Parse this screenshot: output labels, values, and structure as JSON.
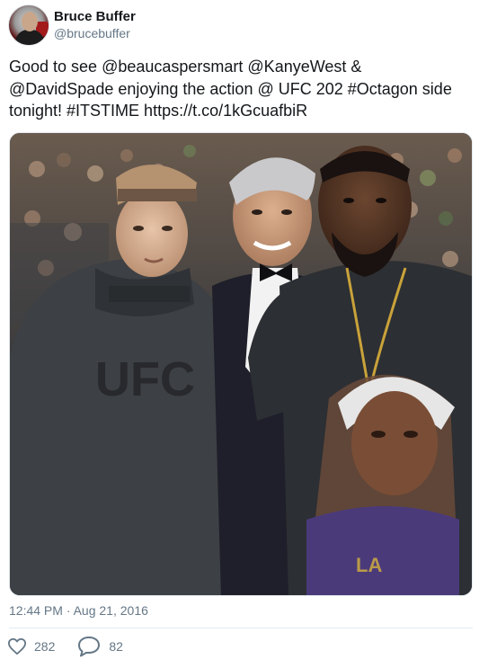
{
  "author": {
    "display_name": "Bruce Buffer",
    "handle": "@brucebuffer"
  },
  "tweet": {
    "text": "Good to see @beaucaspersmart @KanyeWest &\n@DavidSpade enjoying the action @ UFC 202 #Octagon side\ntonight! #ITSTIME https://t.co/1kGcuafbiR",
    "photo_shirt_text": "UFC",
    "timestamp": "12:44 PM · Aug 21, 2016"
  },
  "actions": {
    "like_icon": "heart-icon",
    "like_count": "282",
    "reply_icon": "speech-bubble-icon",
    "reply_count": "82"
  },
  "colors": {
    "text": "#14171a",
    "secondary": "#657786",
    "divider": "#e6ecf0"
  }
}
